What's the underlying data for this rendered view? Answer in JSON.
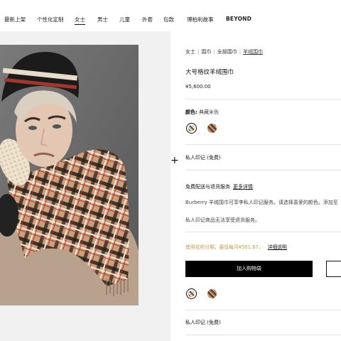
{
  "nav": {
    "items": [
      "最新上架",
      "个性化定制",
      "女士",
      "男士",
      "儿童",
      "外套",
      "包款",
      "博柏利故事"
    ],
    "brand": "BEYOND"
  },
  "breadcrumb": {
    "items": [
      "女士",
      "围巾",
      "全部围巾",
      "羊绒围巾"
    ]
  },
  "product": {
    "title": "大号格纹羊绒围巾",
    "price": "¥5,600.00",
    "color_label": "颜色:",
    "color_value": "典藏米色",
    "monogram_label": "私人印记",
    "monogram_note": "(免费)",
    "delivery_label": "免费配送与退货服务",
    "delivery_link": "更多详情",
    "description": "Burberry 羊绒围巾可享李私人印记服务。请选择喜爱的颜色。添加至",
    "monogram_warning": "私人印记商品无法享受退货服务。",
    "finance_text": "使用花呗分期，最低每月¥501.67。",
    "finance_link": "详细说明",
    "add_to_bag": "加入购物袋",
    "monogram_label_2": "私人印记",
    "monogram_note_2": "(免费)"
  },
  "colors": {
    "background": "#ffffff",
    "button": "#000000",
    "finance_text": "#c59a4a"
  },
  "icons": {
    "zoom_cursor": "+"
  }
}
